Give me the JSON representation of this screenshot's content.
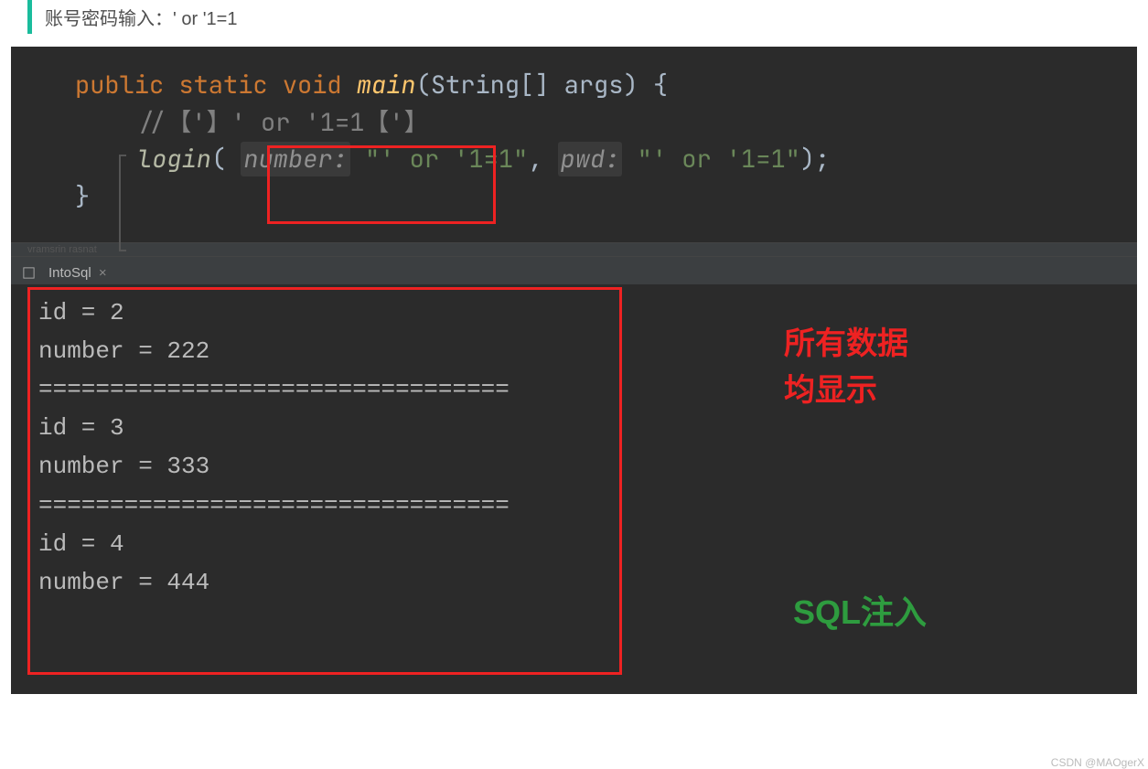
{
  "quote": "账号密码输入：' or '1=1",
  "code": {
    "l1_kw1": "public",
    "l1_kw2": "static",
    "l1_kw3": "void",
    "l1_fn": "main",
    "l1_rest": "(String[] args) {",
    "l2_cmt": "//【'】' or '1=1【'】",
    "l3_fn": "login",
    "l3_op": "( ",
    "l3_p1": "number:",
    "l3_s1": "\"' or '1=1\"",
    "l3_comma": ", ",
    "l3_p2": "pwd:",
    "l3_s2": "\"' or '1=1\"",
    "l3_end": ");",
    "l4": "}"
  },
  "tab": {
    "name": "IntoSql"
  },
  "output": {
    "lines": [
      "id = 2",
      "number = 222",
      "=================================",
      "id = 3",
      "number = 333",
      "=================================",
      "id = 4",
      "number = 444"
    ]
  },
  "annotations": {
    "red_l1": "所有数据",
    "red_l2": "均显示",
    "green": "SQL注入"
  },
  "watermark": "CSDN @MAOgerX"
}
